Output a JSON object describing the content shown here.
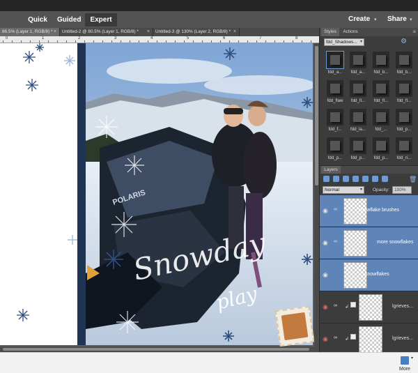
{
  "modes": {
    "quick": "Quick",
    "guided": "Guided",
    "expert": "Expert"
  },
  "menu": {
    "create": "Create",
    "share": "Share",
    "caret": "▾"
  },
  "doc_tabs": [
    {
      "label": "66.5% (Layer 1, RGB/8) *",
      "close": "×"
    },
    {
      "label": "Untitled-2 @ 80.5% (Layer 1, RGB/8) *",
      "close": "×"
    },
    {
      "label": "Untitled-3 @ 130% (Layer 2, RGB/8) *",
      "close": "×"
    }
  ],
  "ruler": {
    "labels": [
      "0",
      "1",
      "2",
      "3",
      "4",
      "5",
      "6",
      "7",
      "8"
    ]
  },
  "canvas": {
    "title_word": "Snowday",
    "subtitle_word": "play",
    "colors": {
      "spine": "#1f3553",
      "snowflake": "#2f4f7f"
    }
  },
  "styles_panel": {
    "tabs": {
      "styles": "Styles",
      "actions": "Actions"
    },
    "menu_icon": "≡",
    "library": "fdd_Shadows...",
    "gear_icon": "⚙",
    "items": [
      "fdd_a...",
      "fdd_a...",
      "fdd_b...",
      "fdd_b...",
      "fdd_flaw",
      "fdd_fl...",
      "fdd_fl...",
      "fdd_fl...",
      "fdd_f...",
      "fdd_la...",
      "fdd_...",
      "fdd_p...",
      "fdd_p...",
      "fdd_p...",
      "fdd_p...",
      "fdd_ri..."
    ]
  },
  "layers_panel": {
    "tab": "Layers",
    "blend_mode": "Normal",
    "opacity_label": "Opacity:",
    "opacity_value": "100%",
    "trash_icon": "🗑",
    "eye_icon": "◉",
    "link_icon": "∞",
    "clip_icon": "↲",
    "layers": [
      {
        "name": "snowflake brushes",
        "selected": true,
        "visible": true
      },
      {
        "name": "more snowflakes",
        "selected": true,
        "visible": true
      },
      {
        "name": "snowflakes",
        "selected": true,
        "visible": true
      },
      {
        "name": "lgrieves...",
        "selected": false,
        "visible": false
      },
      {
        "name": "lgrieves...",
        "selected": false,
        "visible": false
      }
    ]
  },
  "statusbar": {
    "more": "More"
  }
}
